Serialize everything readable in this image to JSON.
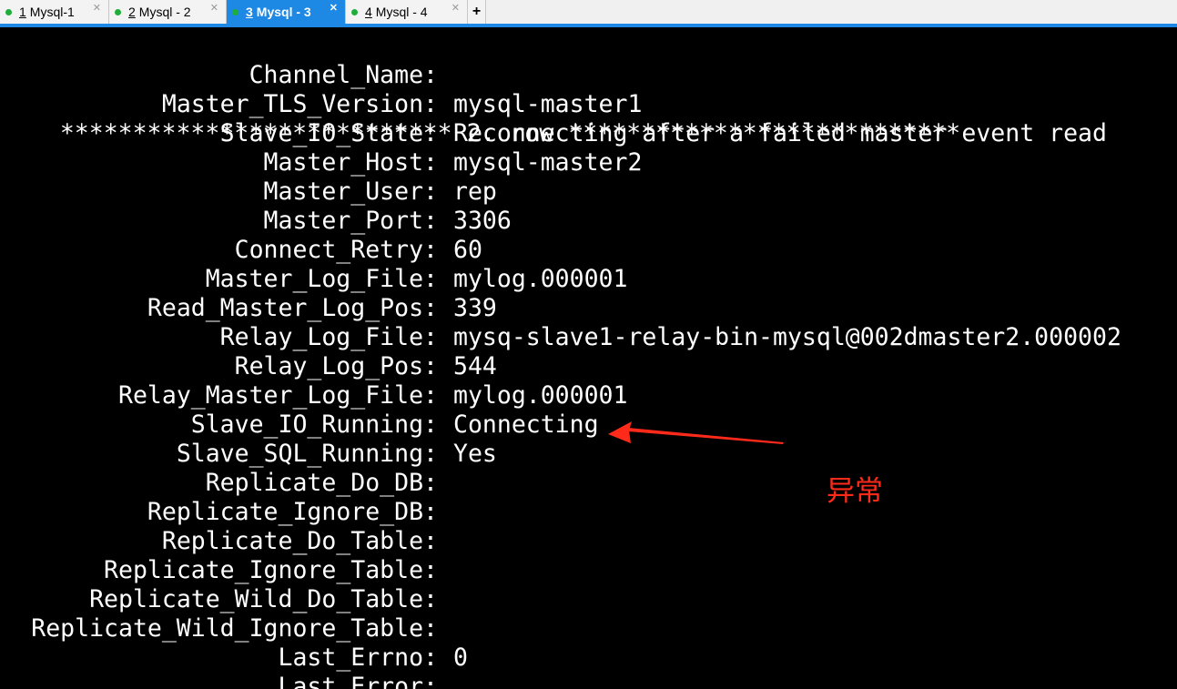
{
  "tabs": [
    {
      "num": "1",
      "label": "Mysql-1",
      "active": false
    },
    {
      "num": "2",
      "label": "Mysql - 2",
      "active": false
    },
    {
      "num": "3",
      "label": "Mysql - 3",
      "active": true
    },
    {
      "num": "4",
      "label": "Mysql - 4",
      "active": false
    }
  ],
  "tab_add_label": "+",
  "terminal": {
    "channel_name": {
      "key": "Channel_Name:",
      "value": "mysql-master1"
    },
    "master_tls_version": {
      "key": "Master_TLS_Version:",
      "value": ""
    },
    "row_separator": {
      "stars_left": "***************************",
      "label": "2. row",
      "stars_right": "***************************"
    },
    "fields": [
      {
        "key": "Slave_IO_State:",
        "value": "Reconnecting after a failed master event read"
      },
      {
        "key": "Master_Host:",
        "value": "mysql-master2"
      },
      {
        "key": "Master_User:",
        "value": "rep"
      },
      {
        "key": "Master_Port:",
        "value": "3306"
      },
      {
        "key": "Connect_Retry:",
        "value": "60"
      },
      {
        "key": "Master_Log_File:",
        "value": "mylog.000001"
      },
      {
        "key": "Read_Master_Log_Pos:",
        "value": "339"
      },
      {
        "key": "Relay_Log_File:",
        "value": "mysq-slave1-relay-bin-mysql@002dmaster2.000002"
      },
      {
        "key": "Relay_Log_Pos:",
        "value": "544"
      },
      {
        "key": "Relay_Master_Log_File:",
        "value": "mylog.000001"
      },
      {
        "key": "Slave_IO_Running:",
        "value": "Connecting"
      },
      {
        "key": "Slave_SQL_Running:",
        "value": "Yes"
      },
      {
        "key": "Replicate_Do_DB:",
        "value": ""
      },
      {
        "key": "Replicate_Ignore_DB:",
        "value": ""
      },
      {
        "key": "Replicate_Do_Table:",
        "value": ""
      },
      {
        "key": "Replicate_Ignore_Table:",
        "value": ""
      },
      {
        "key": "Replicate_Wild_Do_Table:",
        "value": ""
      },
      {
        "key": "Replicate_Wild_Ignore_Table:",
        "value": ""
      },
      {
        "key": "Last_Errno:",
        "value": "0"
      },
      {
        "key": "Last_Error:",
        "value": ""
      }
    ]
  },
  "annotation": {
    "text": "异常",
    "color": "#ff2a1a"
  },
  "colors": {
    "tab_active": "#1e88e5",
    "status_dot": "#1fae3a",
    "terminal_bg": "#000000",
    "terminal_fg": "#ffffff"
  }
}
